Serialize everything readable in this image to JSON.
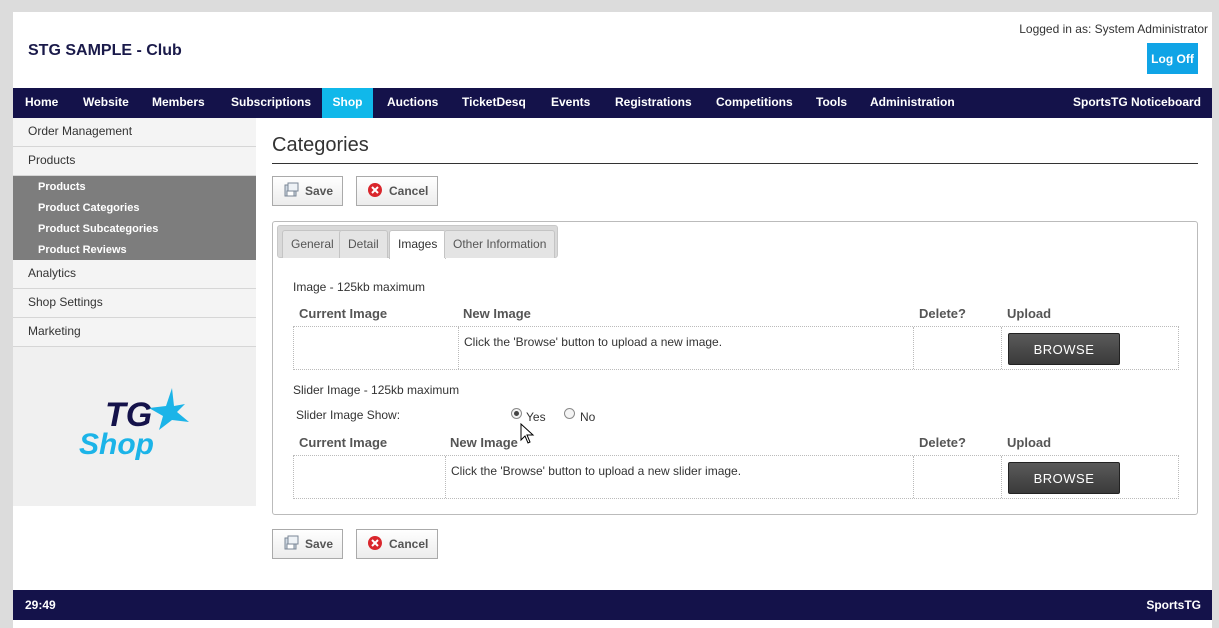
{
  "header": {
    "club_title": "STG SAMPLE - Club",
    "logged_in": "Logged in as: System Administrator",
    "logoff_label": "Log Off"
  },
  "topnav": {
    "items": [
      "Home",
      "Website",
      "Members",
      "Subscriptions",
      "Shop",
      "Auctions",
      "TicketDesq",
      "Events",
      "Registrations",
      "Competitions",
      "Tools",
      "Administration"
    ],
    "active": "Shop",
    "right_label": "SportsTG Noticeboard"
  },
  "sidebar": {
    "items": [
      "Order Management",
      "Products",
      "Analytics",
      "Shop Settings",
      "Marketing"
    ],
    "subitems": [
      "Products",
      "Product Categories",
      "Product Subcategories",
      "Product Reviews"
    ],
    "logo_top": "TG",
    "logo_bottom": "Shop"
  },
  "main": {
    "heading": "Categories",
    "save_label": "Save",
    "cancel_label": "Cancel",
    "tabs": [
      "General",
      "Detail",
      "Images",
      "Other Information"
    ],
    "active_tab": "Images",
    "image_section": {
      "title": "Image - 125kb maximum",
      "columns": [
        "Current Image",
        "New Image",
        "Delete?",
        "Upload"
      ],
      "hint": "Click the 'Browse' button to upload a new image.",
      "browse_label": "BROWSE"
    },
    "slider_section": {
      "title": "Slider Image - 125kb maximum",
      "show_label": "Slider Image Show:",
      "yes_label": "Yes",
      "no_label": "No",
      "selected": "Yes",
      "columns": [
        "Current Image",
        "New Image",
        "Delete?",
        "Upload"
      ],
      "hint": "Click the 'Browse' button to upload a new slider image.",
      "browse_label": "BROWSE"
    }
  },
  "footer": {
    "clock": "29:49",
    "brand": "SportsTG"
  },
  "colors": {
    "nav_bg": "#14124a",
    "active_nav": "#10b8ea",
    "logoff_bg": "#10a4e6",
    "subnav_bg": "#7d7d7d",
    "logo_blue": "#1cb4e8",
    "logo_navy": "#14124a"
  }
}
